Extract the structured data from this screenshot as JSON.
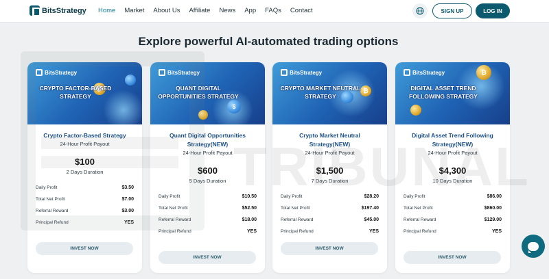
{
  "header": {
    "brand": "BitsStrategy",
    "nav": [
      {
        "label": "Home",
        "active": true
      },
      {
        "label": "Market",
        "active": false
      },
      {
        "label": "About Us",
        "active": false
      },
      {
        "label": "Affiliate",
        "active": false
      },
      {
        "label": "News",
        "active": false
      },
      {
        "label": "App",
        "active": false
      },
      {
        "label": "FAQs",
        "active": false
      },
      {
        "label": "Contact",
        "active": false
      }
    ],
    "signup_label": "SIGN UP",
    "login_label": "LOG IN"
  },
  "section_title": "Explore powerful AI-automated trading options",
  "watermark": "TRIBUNAL",
  "colors": {
    "primary": "#0c5a6e",
    "active_nav": "#127a92",
    "plan_name": "#1d4f84"
  },
  "plans": [
    {
      "banner_brand": "BitsStrategy",
      "banner_title": "CRYPTO FACTOR-BASED STRATEGY",
      "name": "Crypto Factor-Based Strategy",
      "payout": "24-Hour Profit Payout",
      "price": "$100",
      "duration": "2 Days Duration",
      "rows": [
        {
          "label": "Daily Profit",
          "value": "$3.50"
        },
        {
          "label": "Total Net Profit",
          "value": "$7.00"
        },
        {
          "label": "Referral Reward",
          "value": "$3.00"
        },
        {
          "label": "Principal Refund",
          "value": "YES"
        }
      ],
      "button": "INVEST NOW"
    },
    {
      "banner_brand": "BitsStrategy",
      "banner_title": "QUANT DIGITAL OPPORTUNITIES STRATEGY",
      "name": "Quant Digital Opportunities Strategy(NEW)",
      "payout": "24-Hour Profit Payout",
      "price": "$600",
      "duration": "5 Days Duration",
      "rows": [
        {
          "label": "Daily Profit",
          "value": "$10.50"
        },
        {
          "label": "Total Net Profit",
          "value": "$52.50"
        },
        {
          "label": "Referral Reward",
          "value": "$18.00"
        },
        {
          "label": "Principal Refund",
          "value": "YES"
        }
      ],
      "button": "INVEST NOW"
    },
    {
      "banner_brand": "BitsStrategy",
      "banner_title": "CRYPTO MARKET NEUTRAL STRATEGY",
      "name": "Crypto Market Neutral Strategy(NEW)",
      "payout": "24-Hour Profit Payout",
      "price": "$1,500",
      "duration": "7 Days Duration",
      "rows": [
        {
          "label": "Daily Profit",
          "value": "$28.20"
        },
        {
          "label": "Total Net Profit",
          "value": "$197.40"
        },
        {
          "label": "Referral Reward",
          "value": "$45.00"
        },
        {
          "label": "Principal Refund",
          "value": "YES"
        }
      ],
      "button": "INVEST NOW"
    },
    {
      "banner_brand": "BitsStrategy",
      "banner_title": "DIGITAL ASSET TREND FOLLOWING STRATEGY",
      "name": "Digital Asset Trend Following Strategy(NEW)",
      "payout": "24-Hour Profit Payout",
      "price": "$4,300",
      "duration": "10 Days Duration",
      "rows": [
        {
          "label": "Daily Profit",
          "value": "$86.00"
        },
        {
          "label": "Total Net Profit",
          "value": "$860.00"
        },
        {
          "label": "Referral Reward",
          "value": "$129.00"
        },
        {
          "label": "Principal Refund",
          "value": "YES"
        }
      ],
      "button": "INVEST NOW"
    }
  ]
}
